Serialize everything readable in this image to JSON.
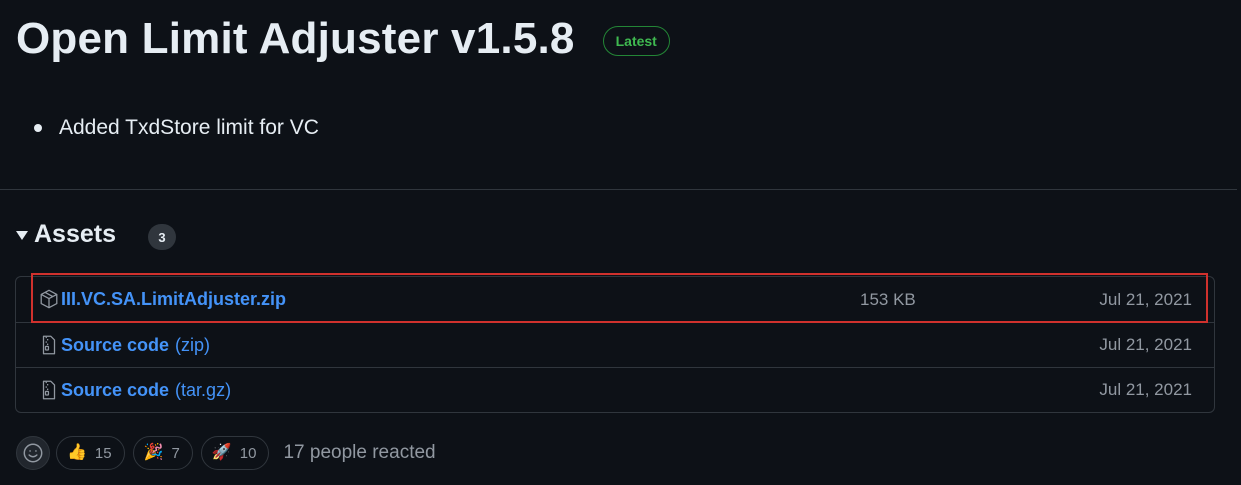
{
  "release": {
    "title": "Open Limit Adjuster v1.5.8",
    "badge": "Latest",
    "notes": [
      "Added TxdStore limit for VC"
    ]
  },
  "assets": {
    "title": "Assets",
    "count": "3",
    "items": [
      {
        "name": "III.VC.SA.LimitAdjuster.zip",
        "suffix": "",
        "size": "153 KB",
        "date": "Jul 21, 2021",
        "icon": "package-icon"
      },
      {
        "name": "Source code",
        "suffix": "(zip)",
        "size": "",
        "date": "Jul 21, 2021",
        "icon": "file-zip-icon"
      },
      {
        "name": "Source code",
        "suffix": "(tar.gz)",
        "size": "",
        "date": "Jul 21, 2021",
        "icon": "file-zip-icon"
      }
    ]
  },
  "reactions": {
    "items": [
      {
        "emoji": "👍",
        "count": "15",
        "name": "thumbs-up"
      },
      {
        "emoji": "🎉",
        "count": "7",
        "name": "hooray"
      },
      {
        "emoji": "🚀",
        "count": "10",
        "name": "rocket"
      }
    ],
    "summary": "17 people reacted"
  },
  "colors": {
    "background": "#0d1117",
    "link": "#4493f8",
    "latest": "#3fb950",
    "highlight": "#d0312d"
  }
}
